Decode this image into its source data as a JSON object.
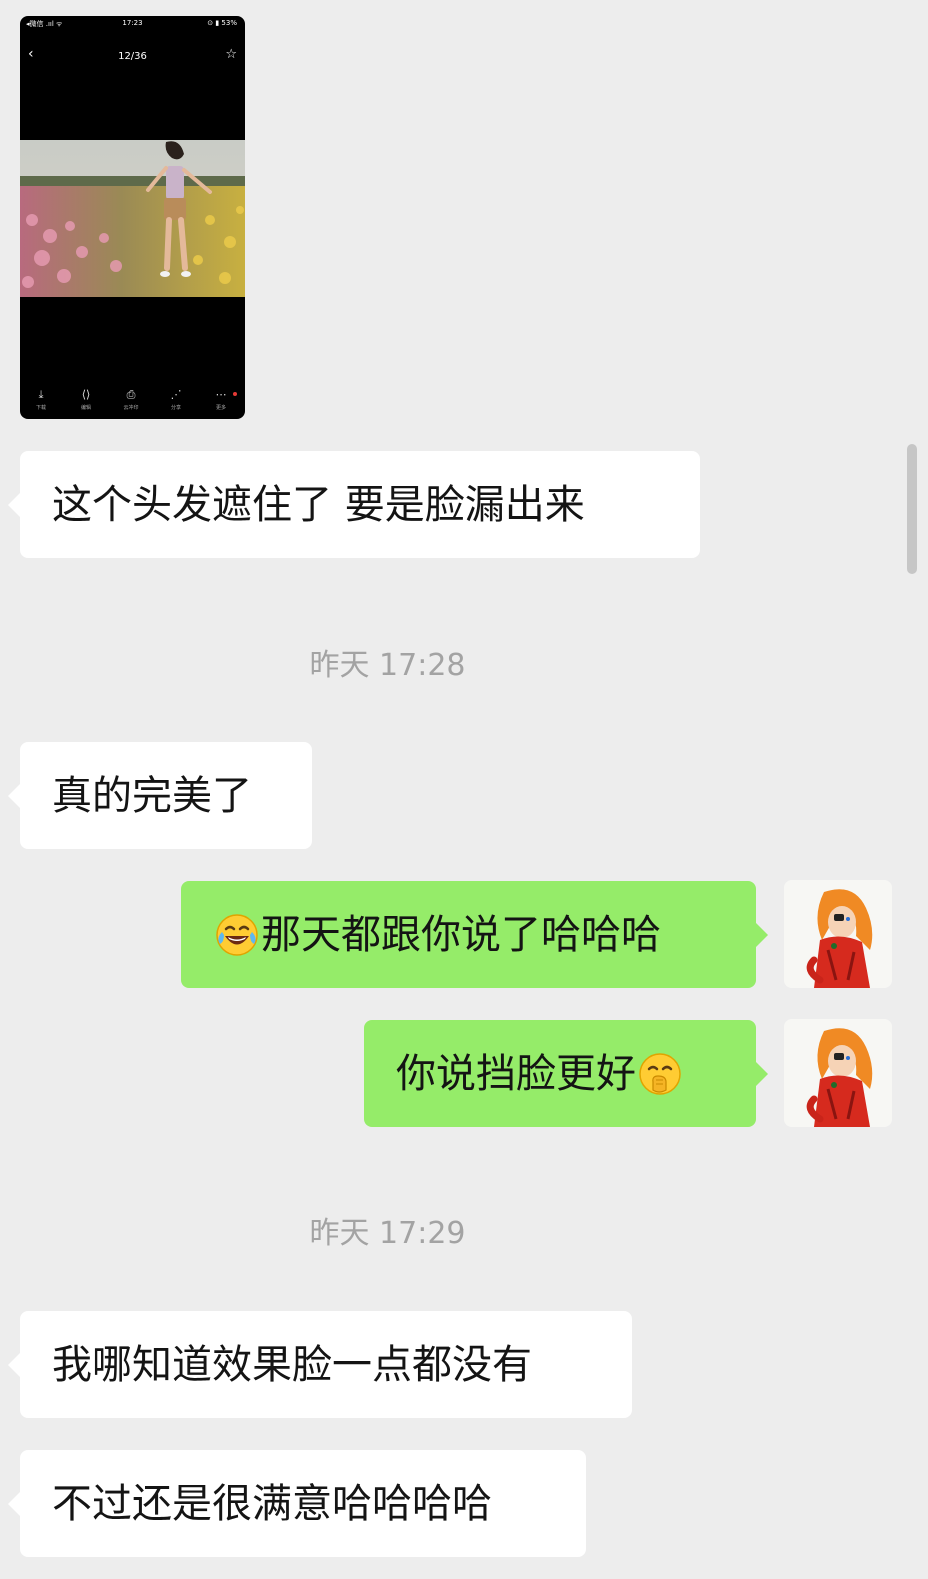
{
  "image_message": {
    "status_left": "◂微信 .ııl ᯤ",
    "status_time": "17:23",
    "status_right": "⊙ ▮ 53%",
    "counter": "12/36",
    "tools": [
      {
        "icon": "download-icon",
        "glyph": "⤓",
        "label": "下载"
      },
      {
        "icon": "edit-icon",
        "glyph": "⟨⟩",
        "label": "编辑"
      },
      {
        "icon": "print-icon",
        "glyph": "⎙",
        "label": "云冲印"
      },
      {
        "icon": "share-icon",
        "glyph": "⋰",
        "label": "分享"
      },
      {
        "icon": "more-icon",
        "glyph": "⋯",
        "label": "更多"
      }
    ]
  },
  "messages": [
    {
      "side": "left",
      "text": "这个头发遮住了  要是脸漏出来"
    },
    {
      "side": "time",
      "text": "昨天 17:28"
    },
    {
      "side": "left",
      "text": "真的完美了"
    },
    {
      "side": "right",
      "emoji_before": "tears-of-joy",
      "text": "那天都跟你说了哈哈哈"
    },
    {
      "side": "right",
      "text": "你说挡脸更好",
      "emoji_after": "giggle"
    },
    {
      "side": "time",
      "text": "昨天 17:29"
    },
    {
      "side": "left",
      "text": "我哪知道效果脸一点都没有"
    },
    {
      "side": "left",
      "text": "不过还是很满意哈哈哈哈"
    }
  ],
  "colors": {
    "background": "#ededed",
    "bubble_left": "#ffffff",
    "bubble_right": "#95ec69",
    "timestamp": "#a3a3a3"
  }
}
